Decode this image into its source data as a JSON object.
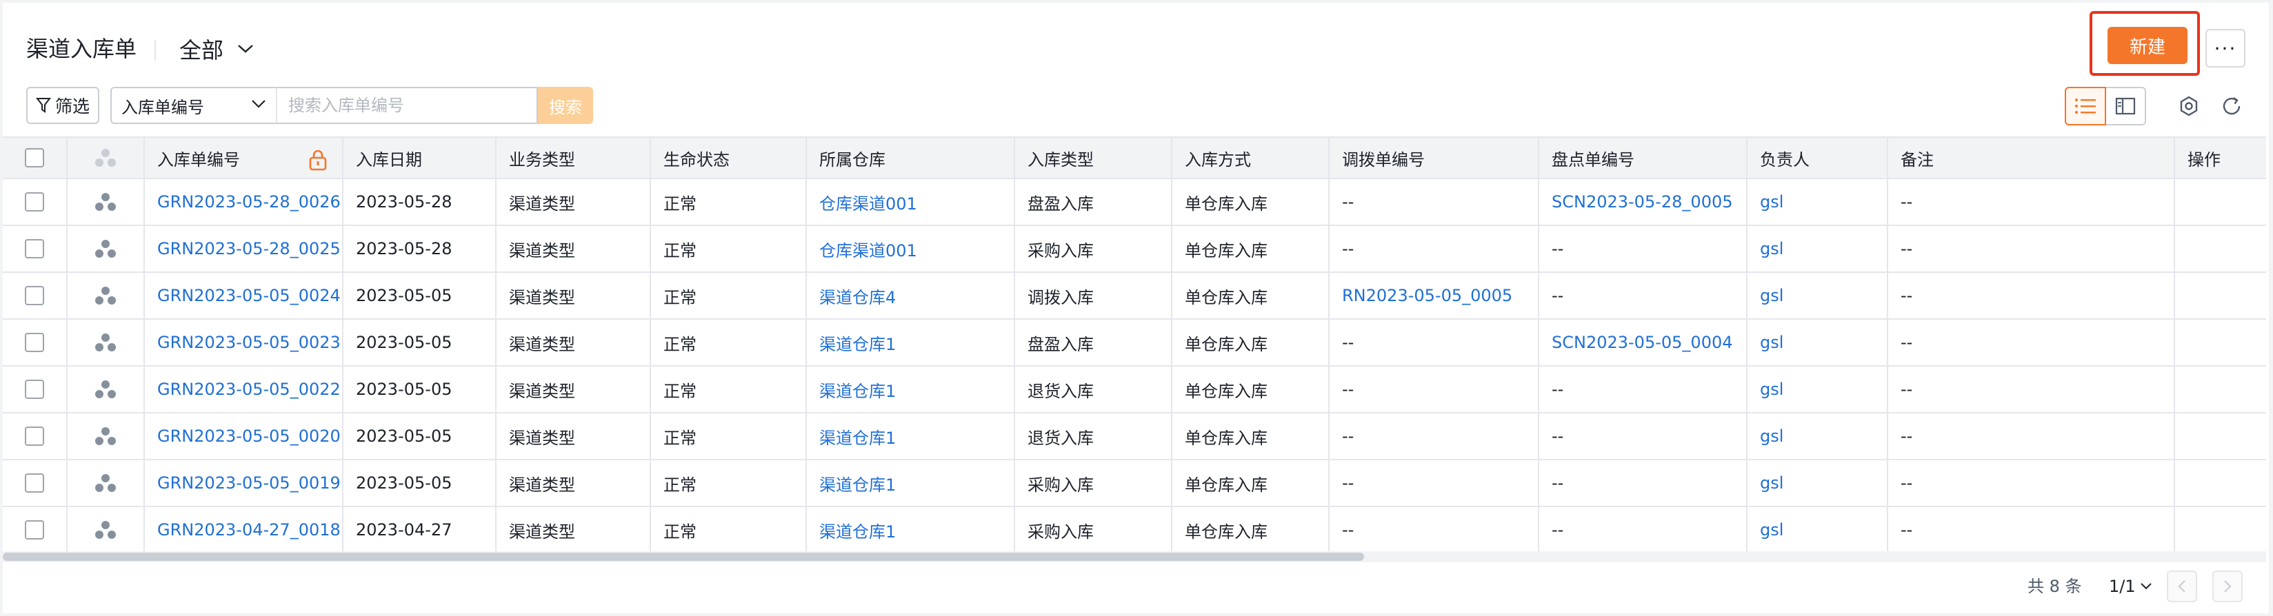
{
  "header": {
    "title": "渠道入库单",
    "view_label": "全部",
    "new_button": "新建",
    "more_button": "···"
  },
  "toolbar": {
    "filter_label": "筛选",
    "field_select": "入库单编号",
    "search_placeholder": "搜索入库单编号",
    "search_button": "搜索"
  },
  "table": {
    "columns": [
      "入库单编号",
      "入库日期",
      "业务类型",
      "生命状态",
      "所属仓库",
      "入库类型",
      "入库方式",
      "调拨单编号",
      "盘点单编号",
      "负责人",
      "备注",
      "操作"
    ],
    "rows": [
      {
        "no": "GRN2023-05-28_0026",
        "date": "2023-05-28",
        "biz": "渠道类型",
        "status": "正常",
        "warehouse": "仓库渠道001",
        "type": "盘盈入库",
        "mode": "单仓库入库",
        "transfer": "--",
        "check": "SCN2023-05-28_0005",
        "owner": "gsl",
        "remark": "--"
      },
      {
        "no": "GRN2023-05-28_0025",
        "date": "2023-05-28",
        "biz": "渠道类型",
        "status": "正常",
        "warehouse": "仓库渠道001",
        "type": "采购入库",
        "mode": "单仓库入库",
        "transfer": "--",
        "check": "--",
        "owner": "gsl",
        "remark": "--"
      },
      {
        "no": "GRN2023-05-05_0024",
        "date": "2023-05-05",
        "biz": "渠道类型",
        "status": "正常",
        "warehouse": "渠道仓库4",
        "type": "调拨入库",
        "mode": "单仓库入库",
        "transfer": "RN2023-05-05_0005",
        "check": "--",
        "owner": "gsl",
        "remark": "--"
      },
      {
        "no": "GRN2023-05-05_0023",
        "date": "2023-05-05",
        "biz": "渠道类型",
        "status": "正常",
        "warehouse": "渠道仓库1",
        "type": "盘盈入库",
        "mode": "单仓库入库",
        "transfer": "--",
        "check": "SCN2023-05-05_0004",
        "owner": "gsl",
        "remark": "--"
      },
      {
        "no": "GRN2023-05-05_0022",
        "date": "2023-05-05",
        "biz": "渠道类型",
        "status": "正常",
        "warehouse": "渠道仓库1",
        "type": "退货入库",
        "mode": "单仓库入库",
        "transfer": "--",
        "check": "--",
        "owner": "gsl",
        "remark": "--"
      },
      {
        "no": "GRN2023-05-05_0020",
        "date": "2023-05-05",
        "biz": "渠道类型",
        "status": "正常",
        "warehouse": "渠道仓库1",
        "type": "退货入库",
        "mode": "单仓库入库",
        "transfer": "--",
        "check": "--",
        "owner": "gsl",
        "remark": "--"
      },
      {
        "no": "GRN2023-05-05_0019",
        "date": "2023-05-05",
        "biz": "渠道类型",
        "status": "正常",
        "warehouse": "渠道仓库1",
        "type": "采购入库",
        "mode": "单仓库入库",
        "transfer": "--",
        "check": "--",
        "owner": "gsl",
        "remark": "--"
      },
      {
        "no": "GRN2023-04-27_0018",
        "date": "2023-04-27",
        "biz": "渠道类型",
        "status": "正常",
        "warehouse": "渠道仓库1",
        "type": "采购入库",
        "mode": "单仓库入库",
        "transfer": "--",
        "check": "--",
        "owner": "gsl",
        "remark": "--"
      }
    ]
  },
  "footer": {
    "total": "共 8 条",
    "page": "1/1"
  },
  "colors": {
    "accent": "#f4762a",
    "link": "#1f6fd6",
    "highlight_border": "#e8331b"
  }
}
